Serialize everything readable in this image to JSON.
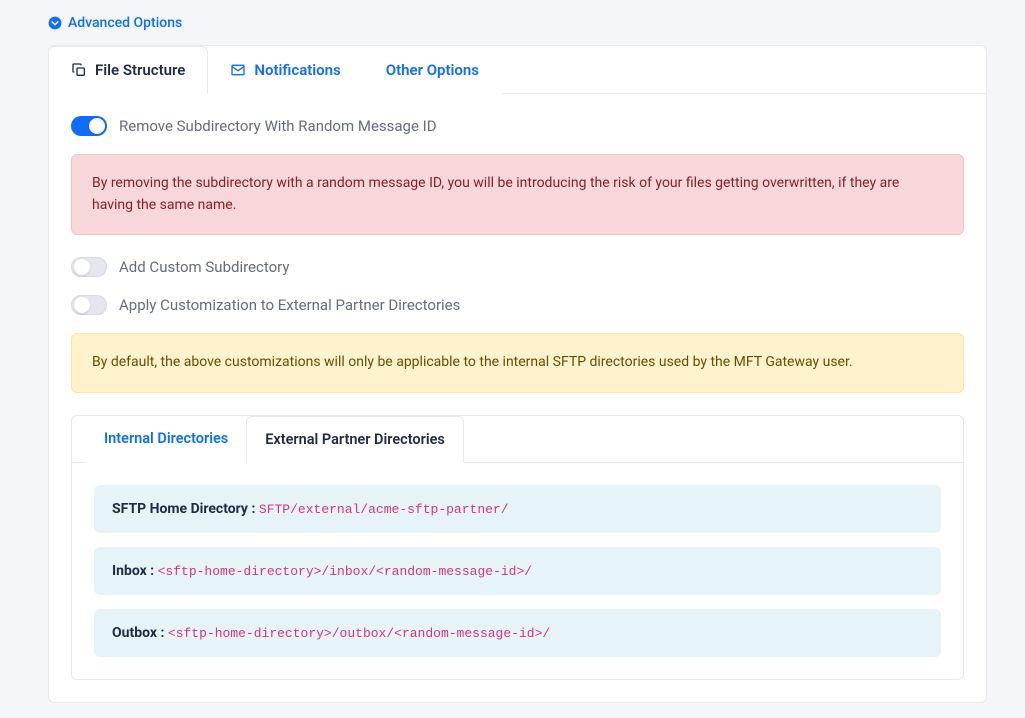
{
  "header": {
    "advanced_label": "Advanced Options"
  },
  "tabs": [
    {
      "label": "File Structure"
    },
    {
      "label": "Notifications"
    },
    {
      "label": "Other Options"
    }
  ],
  "toggles": {
    "remove_subdir": "Remove Subdirectory With Random Message ID",
    "add_custom": "Add Custom Subdirectory",
    "apply_external": "Apply Customization to External Partner Directories"
  },
  "alerts": {
    "danger": "By removing the subdirectory with a random message ID, you will be introducing the risk of your files getting overwritten, if they are having the same name.",
    "warning": "By default, the above customizations will only be applicable to the internal SFTP directories used by the MFT Gateway user."
  },
  "subtabs": [
    {
      "label": "Internal Directories"
    },
    {
      "label": "External Partner Directories"
    }
  ],
  "paths": {
    "home_label": "SFTP Home Directory :",
    "home_value": "SFTP/external/acme-sftp-partner/",
    "inbox_label": "Inbox :",
    "inbox_value": "<sftp-home-directory>/inbox/<random-message-id>/",
    "outbox_label": "Outbox :",
    "outbox_value": "<sftp-home-directory>/outbox/<random-message-id>/"
  }
}
